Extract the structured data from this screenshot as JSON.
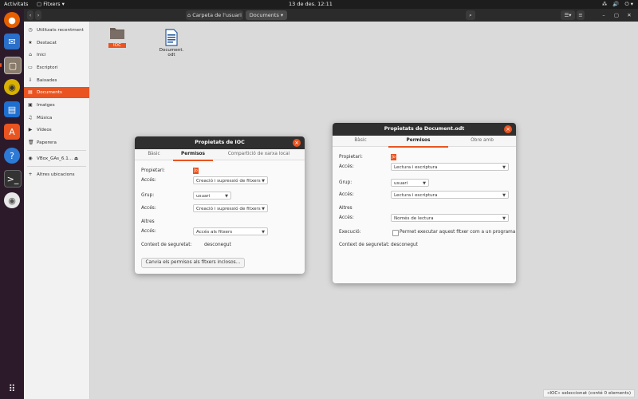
{
  "topbar": {
    "activities": "Activitats",
    "app_menu": "Fitxers ▾",
    "clock": "13 de des.  12:11",
    "tray": [
      "⁂",
      "🔊",
      "⏻ ▾"
    ]
  },
  "header": {
    "path_home": "Carpeta de l'usuari",
    "path_current": "Documents"
  },
  "sidebar": {
    "items": [
      {
        "icon": "clock-icon",
        "glyph": "◷",
        "label": "Utilitzats recentment"
      },
      {
        "icon": "star-icon",
        "glyph": "★",
        "label": "Destacat"
      },
      {
        "icon": "home-icon",
        "glyph": "⌂",
        "label": "Inici"
      },
      {
        "icon": "desktop-icon",
        "glyph": "▭",
        "label": "Escriptori"
      },
      {
        "icon": "download-icon",
        "glyph": "⇩",
        "label": "Baixades"
      },
      {
        "icon": "documents-icon",
        "glyph": "▤",
        "label": "Documents"
      },
      {
        "icon": "images-icon",
        "glyph": "▣",
        "label": "Imatges"
      },
      {
        "icon": "music-icon",
        "glyph": "♫",
        "label": "Música"
      },
      {
        "icon": "video-icon",
        "glyph": "▶",
        "label": "Vídeos"
      },
      {
        "icon": "trash-icon",
        "glyph": "🗑",
        "label": "Paperera"
      },
      {
        "icon": "disc-icon",
        "glyph": "◉",
        "label": "VBox_GAs_6.1...  ⏏"
      },
      {
        "icon": "plus-icon",
        "glyph": "+",
        "label": "Altres ubicacions"
      }
    ]
  },
  "files": [
    {
      "icon": "folder-icon",
      "name": "IOC"
    },
    {
      "icon": "document-icon",
      "name": "Document.\nodt"
    }
  ],
  "status": "«IOC» seleccionat  (conté 0 elements)",
  "dialog_ioc": {
    "title": "Propietats de IOC",
    "tabs": [
      "Bàsic",
      "Permisos",
      "Compartició de xarxa local"
    ],
    "owner_label": "Propietari:",
    "owner_badge": "Jo",
    "access_label": "Accés:",
    "owner_access": "Creació i supressió de fitxers",
    "group_label": "Grup:",
    "group": "usuari",
    "group_access": "Creació i supressió de fitxers",
    "others_label": "Altres",
    "others_access": "Accés als fitxers",
    "security_label": "Context de seguretat:",
    "security_value": "desconegut",
    "button": "Canvia els permisos als fitxers inclosos…"
  },
  "dialog_doc": {
    "title": "Propietats de Document.odt",
    "tabs": [
      "Bàsic",
      "Permisos",
      "Obre amb"
    ],
    "owner_label": "Propietari:",
    "owner_badge": "Jo",
    "access_label": "Accés:",
    "owner_access": "Lectura i escriptura",
    "group_label": "Grup:",
    "group": "usuari",
    "group_access": "Lectura i escriptura",
    "others_label": "Altres",
    "others_access": "Només de lectura",
    "exec_label": "Execució:",
    "exec_text": "Permet executar aquest fitxer com a un programa",
    "security_label": "Context de seguretat:",
    "security_value": "desconegut"
  },
  "colors": {
    "accent": "#e95420",
    "dock": "#2c1a2b",
    "topbar": "#1d1d1d"
  }
}
